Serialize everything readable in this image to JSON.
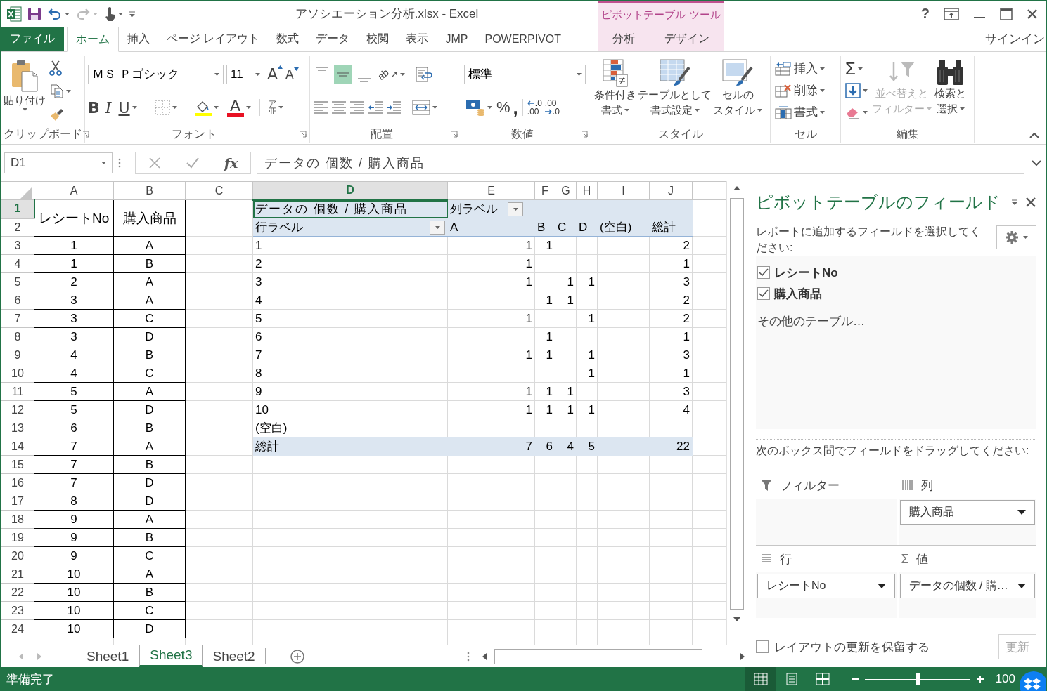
{
  "window": {
    "title": "アソシエーション分析.xlsx - Excel",
    "help": "?",
    "sign_in": "サインイン"
  },
  "context_group": {
    "label": "ピボットテーブル ツール"
  },
  "ribbon_tabs": [
    {
      "label": "ファイル",
      "kind": "file",
      "selected": false
    },
    {
      "label": "ホーム",
      "kind": "main",
      "selected": true
    },
    {
      "label": "挿入",
      "kind": "main",
      "selected": false
    },
    {
      "label": "ページ レイアウト",
      "kind": "main",
      "selected": false
    },
    {
      "label": "数式",
      "kind": "main",
      "selected": false
    },
    {
      "label": "データ",
      "kind": "main",
      "selected": false
    },
    {
      "label": "校閲",
      "kind": "main",
      "selected": false
    },
    {
      "label": "表示",
      "kind": "main",
      "selected": false
    },
    {
      "label": "JMP",
      "kind": "main",
      "selected": false
    },
    {
      "label": "POWERPIVOT",
      "kind": "main",
      "selected": false
    },
    {
      "label": "分析",
      "kind": "context",
      "selected": false
    },
    {
      "label": "デザイン",
      "kind": "context",
      "selected": false
    }
  ],
  "ribbon": {
    "clipboard": {
      "label": "クリップボード",
      "paste": "貼り付け"
    },
    "font": {
      "label": "フォント",
      "name": "ＭＳ Ｐゴシック",
      "size": "11",
      "grow": "A",
      "shrink": "A",
      "bold": "B",
      "italic": "I",
      "underline": "U",
      "font_color": "A",
      "phonetic": [
        "ア",
        "亜"
      ]
    },
    "alignment": {
      "label": "配置",
      "orientation": "ab",
      "vertical": [
        {
          "selected": false
        },
        {
          "selected": true
        },
        {
          "selected": false
        }
      ]
    },
    "number": {
      "label": "数値",
      "format": "標準",
      "percent": "%",
      "comma": ",",
      "increase_decimal": [
        ".0",
        ".00"
      ],
      "decrease_decimal": [
        ".00",
        ".0"
      ]
    },
    "styles": {
      "label": "スタイル",
      "buttons": [
        {
          "lines": [
            "条件付き",
            "書式"
          ]
        },
        {
          "lines": [
            "テーブルとして",
            "書式設定"
          ]
        },
        {
          "lines": [
            "セルの",
            "スタイル"
          ]
        }
      ]
    },
    "cells": {
      "label": "セル",
      "buttons": [
        "挿入",
        "削除",
        "書式"
      ]
    },
    "editing": {
      "label": "編集",
      "sum": "Σ",
      "sort": {
        "lines": [
          "並べ替えと",
          "フィルター"
        ],
        "disabled": true
      },
      "find": {
        "lines": [
          "検索と",
          "選択"
        ],
        "disabled": false
      }
    }
  },
  "formula_bar": {
    "name_box": "D1",
    "fx": "fx",
    "formula": "データの 個数 / 購入商品"
  },
  "sheet": {
    "columns": [
      {
        "label": "A",
        "selected": false
      },
      {
        "label": "B",
        "selected": false
      },
      {
        "label": "C",
        "selected": false
      },
      {
        "label": "D",
        "selected": true
      },
      {
        "label": "E",
        "selected": false
      },
      {
        "label": "F",
        "selected": false
      },
      {
        "label": "G",
        "selected": false
      },
      {
        "label": "H",
        "selected": false
      },
      {
        "label": "I",
        "selected": false
      },
      {
        "label": "J",
        "selected": false
      }
    ],
    "rows": [
      {
        "number": "1",
        "selected": true
      },
      {
        "number": "2",
        "selected": false
      },
      {
        "number": "3",
        "selected": false
      },
      {
        "number": "4",
        "selected": false
      },
      {
        "number": "5",
        "selected": false
      },
      {
        "number": "6",
        "selected": false
      },
      {
        "number": "7",
        "selected": false
      },
      {
        "number": "8",
        "selected": false
      },
      {
        "number": "9",
        "selected": false
      },
      {
        "number": "10",
        "selected": false
      },
      {
        "number": "11",
        "selected": false
      },
      {
        "number": "12",
        "selected": false
      },
      {
        "number": "13",
        "selected": false
      },
      {
        "number": "14",
        "selected": false
      },
      {
        "number": "15",
        "selected": false
      },
      {
        "number": "16",
        "selected": false
      },
      {
        "number": "17",
        "selected": false
      },
      {
        "number": "18",
        "selected": false
      },
      {
        "number": "19",
        "selected": false
      },
      {
        "number": "20",
        "selected": false
      },
      {
        "number": "21",
        "selected": false
      },
      {
        "number": "22",
        "selected": false
      },
      {
        "number": "23",
        "selected": false
      },
      {
        "number": "24",
        "selected": false
      }
    ]
  },
  "source_table": {
    "headers": [
      "レシートNo",
      "購入商品"
    ],
    "rows": [
      [
        "1",
        "A"
      ],
      [
        "1",
        "B"
      ],
      [
        "2",
        "A"
      ],
      [
        "3",
        "A"
      ],
      [
        "3",
        "C"
      ],
      [
        "3",
        "D"
      ],
      [
        "4",
        "B"
      ],
      [
        "4",
        "C"
      ],
      [
        "5",
        "A"
      ],
      [
        "5",
        "D"
      ],
      [
        "6",
        "B"
      ],
      [
        "7",
        "A"
      ],
      [
        "7",
        "B"
      ],
      [
        "7",
        "D"
      ],
      [
        "8",
        "D"
      ],
      [
        "9",
        "A"
      ],
      [
        "9",
        "B"
      ],
      [
        "9",
        "C"
      ],
      [
        "10",
        "A"
      ],
      [
        "10",
        "B"
      ],
      [
        "10",
        "C"
      ],
      [
        "10",
        "D"
      ]
    ]
  },
  "pivot_table": {
    "value_header": {
      "label": "データの 個数 / 購入商品",
      "selected": true
    },
    "column_label": "列ラベル",
    "row_label": "行ラベル",
    "column_headers": [
      "A",
      "B",
      "C",
      "D",
      "(空白)",
      "総計"
    ],
    "rows": [
      {
        "label": "1",
        "values": {
          "E": "1",
          "F": "1",
          "J": "2"
        }
      },
      {
        "label": "2",
        "values": {
          "E": "1",
          "J": "1"
        }
      },
      {
        "label": "3",
        "values": {
          "E": "1",
          "G": "1",
          "H": "1",
          "J": "3"
        }
      },
      {
        "label": "4",
        "values": {
          "F": "1",
          "G": "1",
          "J": "2"
        }
      },
      {
        "label": "5",
        "values": {
          "E": "1",
          "H": "1",
          "J": "2"
        }
      },
      {
        "label": "6",
        "values": {
          "F": "1",
          "J": "1"
        }
      },
      {
        "label": "7",
        "values": {
          "E": "1",
          "F": "1",
          "H": "1",
          "J": "3"
        }
      },
      {
        "label": "8",
        "values": {
          "H": "1",
          "J": "1"
        }
      },
      {
        "label": "9",
        "values": {
          "E": "1",
          "F": "1",
          "G": "1",
          "J": "3"
        }
      },
      {
        "label": "10",
        "values": {
          "E": "1",
          "F": "1",
          "G": "1",
          "H": "1",
          "J": "4"
        }
      },
      {
        "label": "(空白)"
      }
    ],
    "total": {
      "label": "総計",
      "values": {
        "E": "7",
        "F": "6",
        "G": "4",
        "H": "5",
        "J": "22"
      }
    }
  },
  "sheet_tabs": [
    {
      "label": "Sheet1",
      "selected": false
    },
    {
      "label": "Sheet3",
      "selected": true
    },
    {
      "label": "Sheet2",
      "selected": false
    }
  ],
  "status_bar": {
    "status": "準備完了",
    "views": [
      {
        "selected": true
      },
      {
        "selected": false
      },
      {
        "selected": false
      }
    ],
    "zoom": {
      "level": 0.5,
      "label": "100"
    }
  },
  "field_list": {
    "title": "ピボットテーブルのフィールド",
    "instruction": "レポートに追加するフィールドを選択してください:",
    "fields": [
      {
        "label": "レシートNo",
        "checked": true
      },
      {
        "label": "購入商品",
        "checked": true
      }
    ],
    "more_tables": "その他のテーブル…",
    "drag_hint": "次のボックス間でフィールドをドラッグしてください:",
    "areas": [
      {
        "kind": "filter",
        "label": "フィルター"
      },
      {
        "kind": "columns",
        "label": "列",
        "items": [
          "購入商品"
        ]
      },
      {
        "kind": "rows",
        "label": "行",
        "items": [
          "レシートNo"
        ]
      },
      {
        "kind": "values",
        "label": "値",
        "symbol": "Σ",
        "items": [
          "データの個数 / 購…"
        ]
      }
    ],
    "defer_update": {
      "label": "レイアウトの更新を保留する",
      "checked": false
    },
    "update_button": {
      "label": "更新",
      "disabled": true
    }
  }
}
